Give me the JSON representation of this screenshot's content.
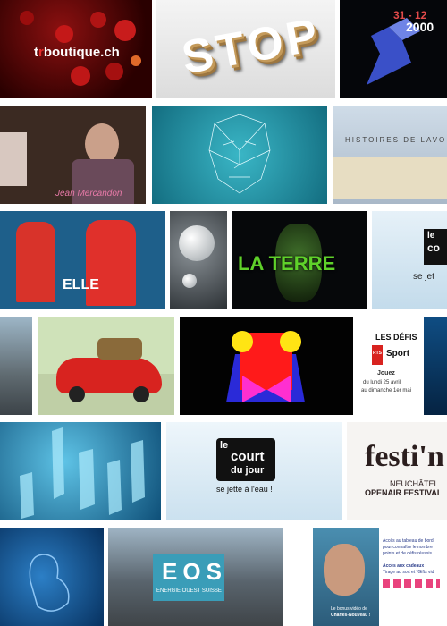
{
  "tiles": {
    "t1": {
      "brand": "boutique.ch",
      "brand_prefix": "t",
      "brand_mid": "r"
    },
    "t2": {
      "word": "STOP"
    },
    "t3": {
      "date_top": "31 - 12",
      "date_bottom": "2000"
    },
    "t4": {
      "signature": "Jean Mercandon"
    },
    "t5": {},
    "t6": {
      "title": "HISTOIRES DE LAVOIRS"
    },
    "t7": {
      "banner": "ELLE"
    },
    "t8": {},
    "t9": {
      "title": "LA TERRE"
    },
    "t10": {
      "logo_l1": "le",
      "logo_l2": "co",
      "tagline": "se jet"
    },
    "t11": {},
    "t12": {},
    "t13": {},
    "t14": {
      "line1": "LES DÉFIS",
      "badge_rts": "RTS",
      "badge_sport": "Sport",
      "line2": "Jouez",
      "line3": "du lundi 25 avril",
      "line4": "au dimanche 1er mai"
    },
    "t15": {},
    "t16": {},
    "t17": {
      "logo_l1": "le",
      "logo_l2": "court",
      "logo_l3": "du jour",
      "tagline": "se jette à l'eau !"
    },
    "t18": {
      "title": "festi'n",
      "sub1": "NEUCHÂTEL",
      "sub2": "OPENAIR FESTIVAL"
    },
    "t19": {},
    "t20": {
      "logo": "EOS",
      "tagline": "ENERGIE OUEST SUISSE"
    },
    "t21": {
      "p1": "Accès au tableau de bord",
      "p2": "pour connaître le nombre",
      "p3": "points et de défis réussis.",
      "p4": "Accès aux cadeaux :",
      "p5": "Tirage au sort et \"Gifts vid",
      "p6": "Le bonus vidéo de",
      "p7": "Charles-Nouveau !"
    }
  },
  "colors": {
    "accent_red": "#d8231f",
    "eos_blue": "#3a9db8"
  }
}
